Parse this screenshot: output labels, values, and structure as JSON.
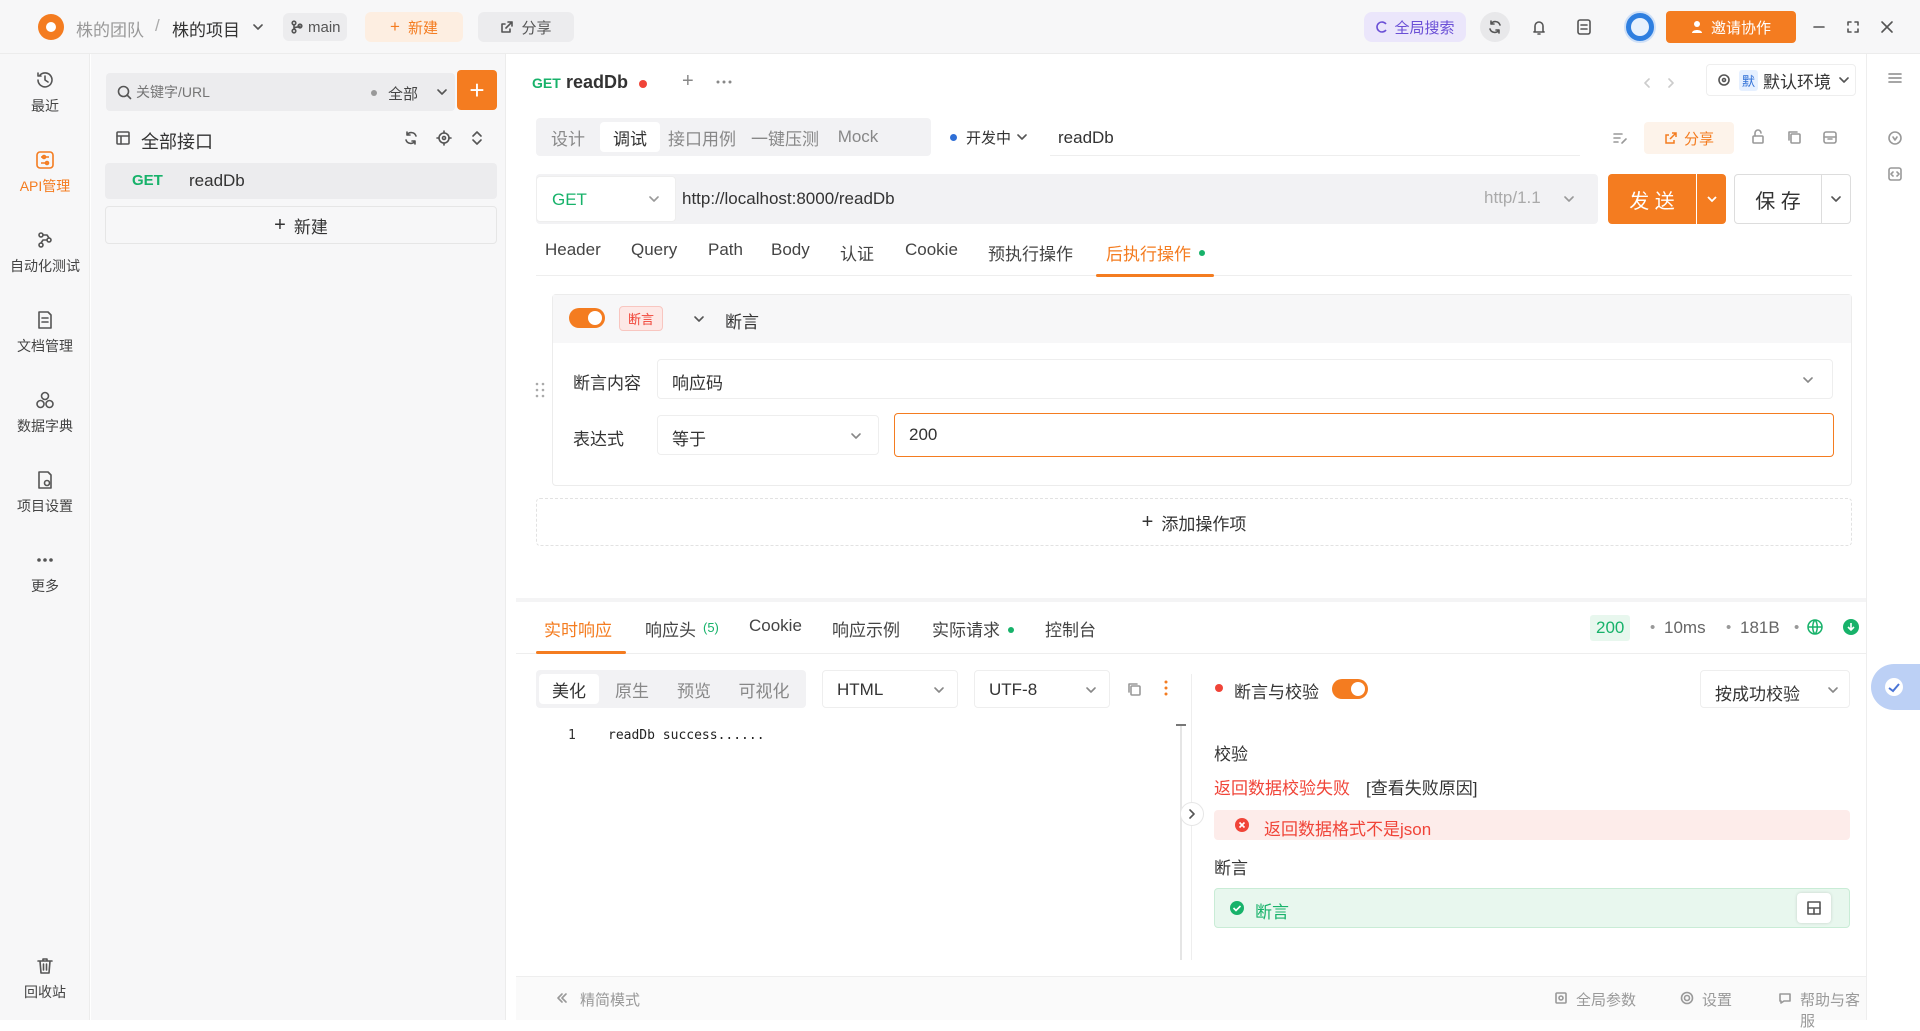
{
  "topbar": {
    "team": "株的团队",
    "separator": "/",
    "project": "株的项目",
    "branch": "main",
    "new_label": "新建",
    "share_label": "分享",
    "global_search": "全局搜索",
    "invite_label": "邀请协作"
  },
  "nav": [
    {
      "label": "最近",
      "icon": "history-icon"
    },
    {
      "label": "API管理",
      "icon": "api-icon"
    },
    {
      "label": "自动化测试",
      "icon": "automation-icon"
    },
    {
      "label": "文档管理",
      "icon": "document-icon"
    },
    {
      "label": "数据字典",
      "icon": "dictionary-icon"
    },
    {
      "label": "项目设置",
      "icon": "settings-icon"
    },
    {
      "label": "更多",
      "icon": "more-icon"
    },
    {
      "label": "回收站",
      "icon": "trash-icon"
    }
  ],
  "tree": {
    "search_placeholder": "关键字/URL",
    "filter": "全部",
    "root_label": "全部接口",
    "items": [
      {
        "method": "GET",
        "name": "readDb"
      }
    ],
    "new_label": "新建"
  },
  "tabs": {
    "active": {
      "method": "GET",
      "name": "readDb"
    },
    "env": "默认环境",
    "env_badge": "默"
  },
  "modes": [
    "设计",
    "调试",
    "接口用例",
    "一键压测",
    "Mock"
  ],
  "status": "开发中",
  "api_name": "readDb",
  "share_label": "分享",
  "request": {
    "method": "GET",
    "url": "http://localhost:8000/readDb",
    "protocol": "http/1.1",
    "send_label": "发 送",
    "save_label": "保 存"
  },
  "req_tabs": [
    "Header",
    "Query",
    "Path",
    "Body",
    "认证",
    "Cookie",
    "预执行操作",
    "后执行操作"
  ],
  "assertion": {
    "tag": "断言",
    "title": "断言",
    "content_label": "断言内容",
    "content_value": "响应码",
    "expr_label": "表达式",
    "operator": "等于",
    "value": "200",
    "add_label": "添加操作项"
  },
  "resp_tabs": [
    {
      "label": "实时响应"
    },
    {
      "label": "响应头",
      "count": "(5)"
    },
    {
      "label": "Cookie"
    },
    {
      "label": "响应示例"
    },
    {
      "label": "实际请求"
    },
    {
      "label": "控制台"
    }
  ],
  "resp_meta": {
    "status": "200",
    "time": "10ms",
    "size": "181B"
  },
  "view_modes": [
    "美化",
    "原生",
    "预览",
    "可视化"
  ],
  "format": "HTML",
  "encoding": "UTF-8",
  "body_line": {
    "num": "1",
    "text": "readDb success......"
  },
  "check": {
    "title": "断言与校验",
    "mode": "按成功校验",
    "section_check": "校验",
    "fail_text": "返回数据校验失败",
    "fail_link": "[查看失败原因]",
    "error_text": "返回数据格式不是json",
    "section_assert": "断言",
    "assert_ok": "断言"
  },
  "footer": {
    "simple_mode": "精简模式",
    "global_params": "全局参数",
    "settings": "设置",
    "help": "帮助与客服"
  },
  "colors": {
    "accent": "#f47c20",
    "get": "#17b26a",
    "error": "#f04438",
    "success_bg": "#e8f7ee"
  }
}
